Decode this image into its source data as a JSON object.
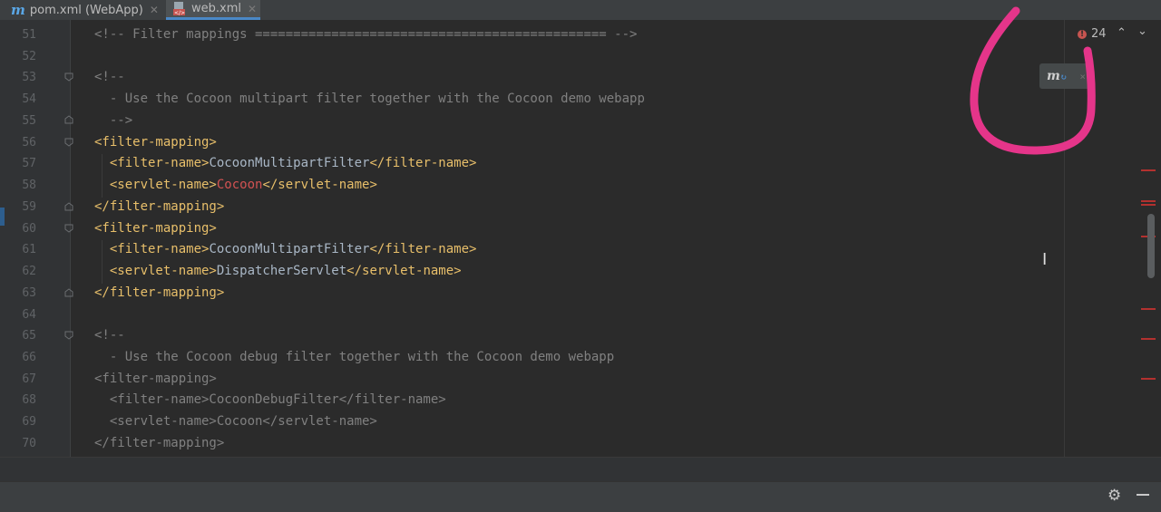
{
  "tabs": [
    {
      "icon": "maven-m-icon",
      "label": "pom.xml (WebApp)",
      "active": false
    },
    {
      "icon": "xml-file-icon",
      "label": "web.xml",
      "active": true
    }
  ],
  "editor": {
    "lines": [
      {
        "n": "51",
        "text": "<!-- Filter mappings ============================================== -->"
      },
      {
        "n": "52",
        "text": ""
      },
      {
        "n": "53",
        "text": "<!--"
      },
      {
        "n": "54",
        "text": "  - Use the Cocoon multipart filter together with the Cocoon demo webapp"
      },
      {
        "n": "55",
        "text": "  -->"
      },
      {
        "n": "56",
        "text": "<filter-mapping>"
      },
      {
        "n": "57",
        "text": "  <filter-name>CocoonMultipartFilter</filter-name>"
      },
      {
        "n": "58",
        "text": "  <servlet-name>Cocoon</servlet-name>"
      },
      {
        "n": "59",
        "text": "</filter-mapping>"
      },
      {
        "n": "60",
        "text": "<filter-mapping>"
      },
      {
        "n": "61",
        "text": "  <filter-name>CocoonMultipartFilter</filter-name>"
      },
      {
        "n": "62",
        "text": "  <servlet-name>DispatcherServlet</servlet-name>"
      },
      {
        "n": "63",
        "text": "</filter-mapping>"
      },
      {
        "n": "64",
        "text": ""
      },
      {
        "n": "65",
        "text": "<!--"
      },
      {
        "n": "66",
        "text": "  - Use the Cocoon debug filter together with the Cocoon demo webapp"
      },
      {
        "n": "67",
        "text": "<filter-mapping>"
      },
      {
        "n": "68",
        "text": "  <filter-name>CocoonDebugFilter</filter-name>"
      },
      {
        "n": "69",
        "text": "  <servlet-name>Cocoon</servlet-name>"
      },
      {
        "n": "70",
        "text": "</filter-mapping>"
      }
    ],
    "tokens": {
      "l51": "<!-- Filter mappings ============================================== -->",
      "l53": "<!--",
      "l54": "  - Use the Cocoon multipart filter together with the Cocoon demo webapp",
      "l55": "  -->",
      "l56": "<filter-mapping>",
      "l57_open": "  <filter-name>",
      "l57_val": "CocoonMultipartFilter",
      "l57_close": "</filter-name>",
      "l58_open": "  <servlet-name>",
      "l58_val": "Cocoon",
      "l58_close": "</servlet-name>",
      "l59": "</filter-mapping>",
      "l60": "<filter-mapping>",
      "l61_open": "  <filter-name>",
      "l61_val": "CocoonMultipartFilter",
      "l61_close": "</filter-name>",
      "l62_open": "  <servlet-name>",
      "l62_val": "DispatcherServlet",
      "l62_close": "</servlet-name>",
      "l63": "</filter-mapping>",
      "l65": "<!--",
      "l66": "  - Use the Cocoon debug filter together with the Cocoon demo webapp",
      "l67": "<filter-mapping>",
      "l68": "  <filter-name>CocoonDebugFilter</filter-name>",
      "l69": "  <servlet-name>Cocoon</servlet-name>",
      "l70": "</filter-mapping>"
    }
  },
  "inspections": {
    "error_count": "24",
    "error_icon": "error-circle-icon",
    "prev_icon": "chevron-up-icon",
    "next_icon": "chevron-down-icon"
  },
  "maven_popup": {
    "icon": "maven-reload-icon",
    "close": "×"
  },
  "bottom": {
    "settings_icon": "gear-icon",
    "hide_icon": "minimize-icon"
  },
  "colors": {
    "tag": "#e8bf6a",
    "comment": "#808080",
    "error": "#d25252",
    "background": "#2b2b2b",
    "annotation": "#e5358a"
  }
}
